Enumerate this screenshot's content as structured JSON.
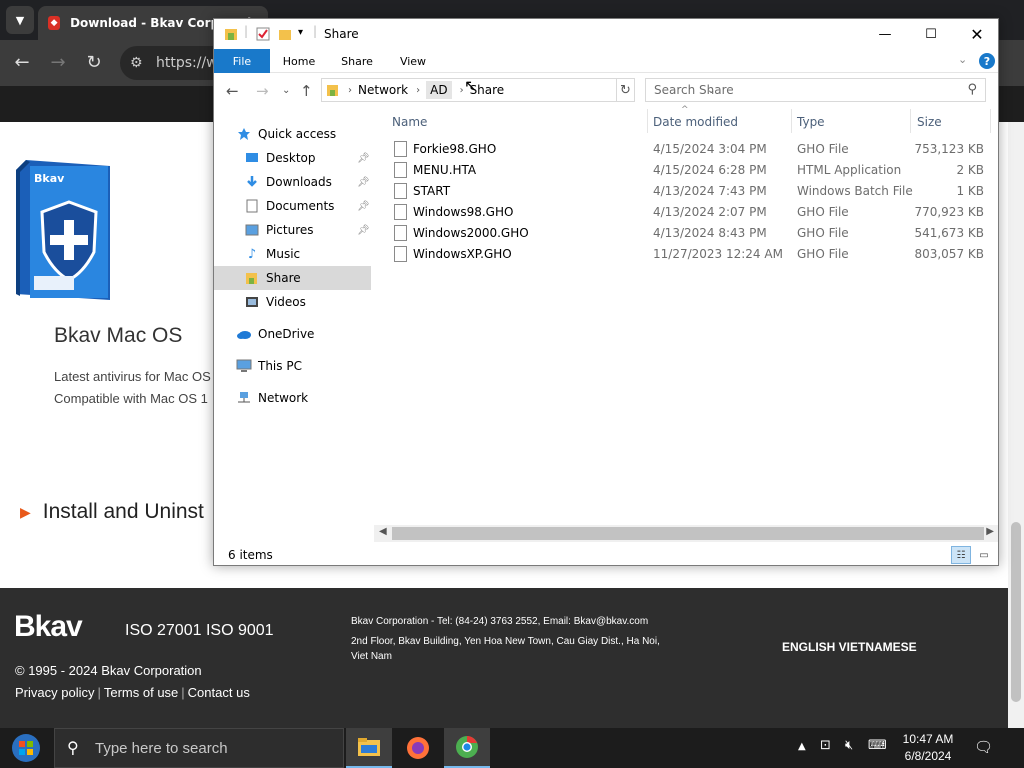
{
  "browser": {
    "tab_title": "Download - Bkav Corporation",
    "tab_close": "×",
    "url": "https://w",
    "back": "←",
    "forward": "→",
    "reload": "↻"
  },
  "page": {
    "product_title": "Bkav Mac OS",
    "desc_line1": "Latest antivirus for Mac OS",
    "desc_line2": "Compatible with Mac OS 1",
    "install_heading": "Install and Uninst",
    "box_brand": "Bkav"
  },
  "footer": {
    "logo": "Bkav",
    "iso": "ISO 27001 ISO 9001",
    "copyright": "© 1995 - 2024 Bkav Corporation",
    "links": [
      "Privacy policy",
      "Terms of use",
      "Contact us"
    ],
    "contact_line1": "Bkav Corporation - Tel: (84-24) 3763 2552, Email: Bkav@bkav.com",
    "contact_line2": "2nd Floor, Bkav Building, Yen Hoa New Town, Cau Giay Dist., Ha Noi, Viet Nam",
    "languages": "ENGLISH VIETNAMESE"
  },
  "explorer": {
    "title": "Share",
    "ribbon_tabs": [
      "File",
      "Home",
      "Share",
      "View"
    ],
    "breadcrumb": [
      "Network",
      "AD",
      "Share"
    ],
    "search_placeholder": "Search Share",
    "columns": [
      "Name",
      "Date modified",
      "Type",
      "Size"
    ],
    "nav": [
      {
        "label": "Quick access",
        "icon": "star-icon"
      },
      {
        "label": "Desktop",
        "icon": "desktop-icon",
        "pinned": true
      },
      {
        "label": "Downloads",
        "icon": "download-icon",
        "pinned": true
      },
      {
        "label": "Documents",
        "icon": "document-icon",
        "pinned": true
      },
      {
        "label": "Pictures",
        "icon": "picture-icon",
        "pinned": true
      },
      {
        "label": "Music",
        "icon": "music-icon"
      },
      {
        "label": "Share",
        "icon": "folder-icon",
        "selected": true
      },
      {
        "label": "Videos",
        "icon": "video-icon"
      },
      {
        "label": "OneDrive",
        "icon": "cloud-icon"
      },
      {
        "label": "This PC",
        "icon": "computer-icon"
      },
      {
        "label": "Network",
        "icon": "network-icon"
      }
    ],
    "files": [
      {
        "name": "Forkie98.GHO",
        "date": "4/15/2024 3:04 PM",
        "type": "GHO File",
        "size": "753,123 KB"
      },
      {
        "name": "MENU.HTA",
        "date": "4/15/2024 6:28 PM",
        "type": "HTML Application",
        "size": "2 KB"
      },
      {
        "name": "START",
        "date": "4/13/2024 7:43 PM",
        "type": "Windows Batch File",
        "size": "1 KB"
      },
      {
        "name": "Windows98.GHO",
        "date": "4/13/2024 2:07 PM",
        "type": "GHO File",
        "size": "770,923 KB"
      },
      {
        "name": "Windows2000.GHO",
        "date": "4/13/2024 8:43 PM",
        "type": "GHO File",
        "size": "541,673 KB"
      },
      {
        "name": "WindowsXP.GHO",
        "date": "11/27/2023 12:24 AM",
        "type": "GHO File",
        "size": "803,057 KB"
      }
    ],
    "status": "6 items"
  },
  "taskbar": {
    "search_placeholder": "Type here to search",
    "time": "10:47 AM",
    "date": "6/8/2024"
  }
}
